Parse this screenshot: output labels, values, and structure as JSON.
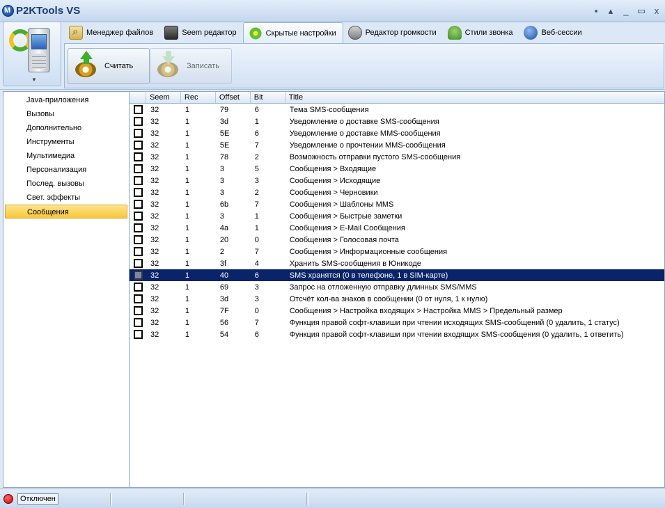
{
  "window": {
    "title": "P2KTools VS",
    "controls": [
      "▪",
      "▴",
      "_",
      "▭",
      "x"
    ]
  },
  "tabs": [
    {
      "label": "Менеджер файлов",
      "icon": "file-manager-icon"
    },
    {
      "label": "Seem редактор",
      "icon": "seem-editor-icon"
    },
    {
      "label": "Скрытые настройки",
      "icon": "hidden-settings-icon",
      "active": true
    },
    {
      "label": "Редактор громкости",
      "icon": "volume-icon"
    },
    {
      "label": "Стили звонка",
      "icon": "ring-style-icon"
    },
    {
      "label": "Веб-сессии",
      "icon": "web-session-icon"
    }
  ],
  "toolbar": {
    "read_label": "Считать",
    "write_label": "Записать"
  },
  "sidebar": {
    "items": [
      "Java-приложения",
      "Вызовы",
      "Дополнительно",
      "Инструменты",
      "Мультимедиа",
      "Персонализация",
      "Послед. вызовы",
      "Свет. эффекты",
      "Сообщения"
    ],
    "selected": "Сообщения"
  },
  "table": {
    "headers": [
      "Seem",
      "Rec",
      "Offset",
      "Bit",
      "Title"
    ],
    "rows": [
      [
        "32",
        "1",
        "79",
        "6",
        "Тема SMS-сообщения"
      ],
      [
        "32",
        "1",
        "3d",
        "1",
        "Уведомление о доставке SMS-сообщения"
      ],
      [
        "32",
        "1",
        "5E",
        "6",
        "Уведомление о доставке MMS-сообщения"
      ],
      [
        "32",
        "1",
        "5E",
        "7",
        "Уведомление о прочтении MMS-сообщения"
      ],
      [
        "32",
        "1",
        "78",
        "2",
        "Возможность отправки пустого SMS-сообщения"
      ],
      [
        "32",
        "1",
        "3",
        "5",
        "Сообщения > Входящие"
      ],
      [
        "32",
        "1",
        "3",
        "3",
        "Сообщения > Исходящие"
      ],
      [
        "32",
        "1",
        "3",
        "2",
        "Сообщения > Черновики"
      ],
      [
        "32",
        "1",
        "6b",
        "7",
        "Сообщения > Шаблоны MMS"
      ],
      [
        "32",
        "1",
        "3",
        "1",
        "Сообщения > Быстрые заметки"
      ],
      [
        "32",
        "1",
        "4a",
        "1",
        "Сообщения > E-Mail Сообщения"
      ],
      [
        "32",
        "1",
        "20",
        "0",
        "Сообщения > Голосовая почта"
      ],
      [
        "32",
        "1",
        "2",
        "7",
        "Сообщения > Информационные сообщения"
      ],
      [
        "32",
        "1",
        "3f",
        "4",
        "Хранить SMS-сообщения в Юникоде"
      ],
      [
        "32",
        "1",
        "40",
        "6",
        "SMS хранятся (0 в телефоне, 1 в SIM-карте)"
      ],
      [
        "32",
        "1",
        "69",
        "3",
        "Запрос на отложенную отправку длинных SMS/MMS"
      ],
      [
        "32",
        "1",
        "3d",
        "3",
        "Отсчёт кол-ва знаков в сообщении (0 от нуля, 1 к нулю)"
      ],
      [
        "32",
        "1",
        "7F",
        "0",
        "Сообщения > Настройка входящих > Настройка MMS > Предельный размер"
      ],
      [
        "32",
        "1",
        "56",
        "7",
        "Функция правой софт-клавиши при чтении исходящих SMS-сообщений (0 удалить, 1 статус)"
      ],
      [
        "32",
        "1",
        "54",
        "6",
        "Функция правой софт-клавиши при чтении входящих SMS-сообщения (0 удалить, 1 ответить)"
      ]
    ],
    "selected_row": 14
  },
  "status": {
    "connection": "Отключен"
  }
}
